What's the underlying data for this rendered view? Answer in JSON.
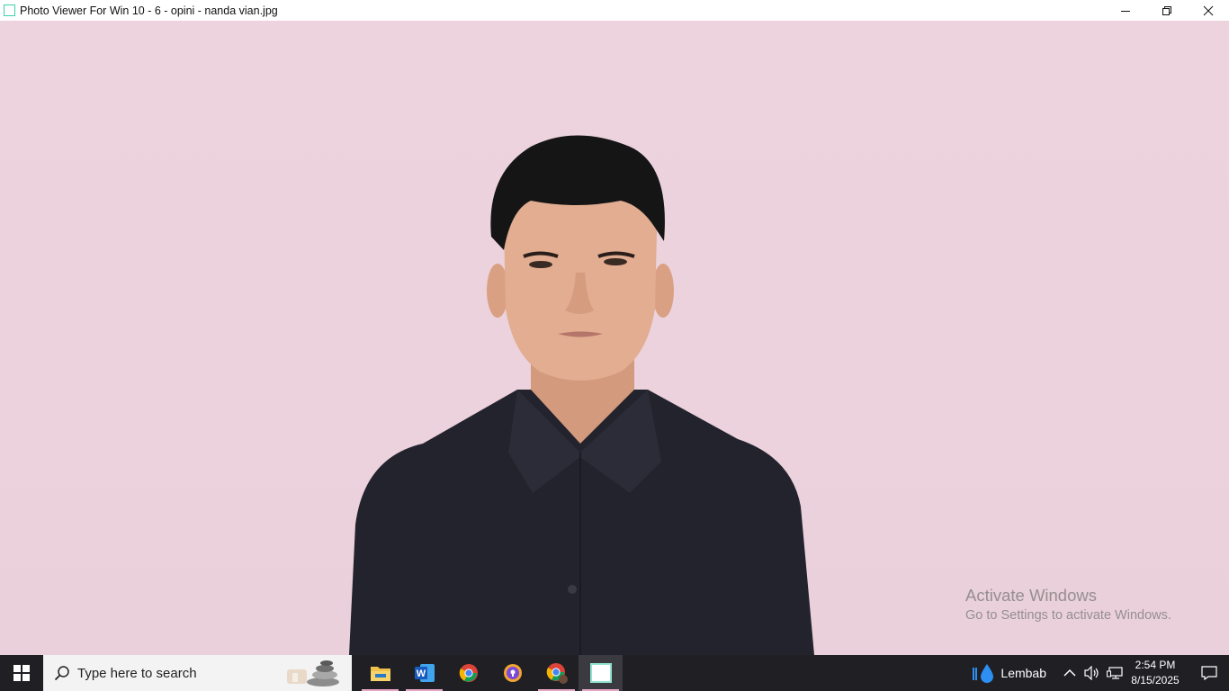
{
  "window": {
    "title": "Photo Viewer For Win 10 - 6 - opini - nanda vian.jpg",
    "controls": {
      "minimize": "minimize-icon",
      "restore": "restore-icon",
      "close": "close-icon"
    }
  },
  "photo": {
    "subject": "portrait-photo",
    "background_color": "#ecd3dd"
  },
  "watermark": {
    "title": "Activate Windows",
    "subtitle": "Go to Settings to activate Windows."
  },
  "taskbar": {
    "start": "windows-start-icon",
    "search_placeholder": "Type here to search",
    "apps": [
      {
        "name": "file-explorer",
        "open": true
      },
      {
        "name": "word",
        "open": true
      },
      {
        "name": "chrome",
        "open": false
      },
      {
        "name": "vpn-app",
        "open": false
      },
      {
        "name": "chrome-profile",
        "open": true
      },
      {
        "name": "photo-viewer",
        "open": true,
        "active": true
      }
    ],
    "weather_label": "Lembab",
    "time": "2:54 PM",
    "date": "8/15/2025"
  }
}
